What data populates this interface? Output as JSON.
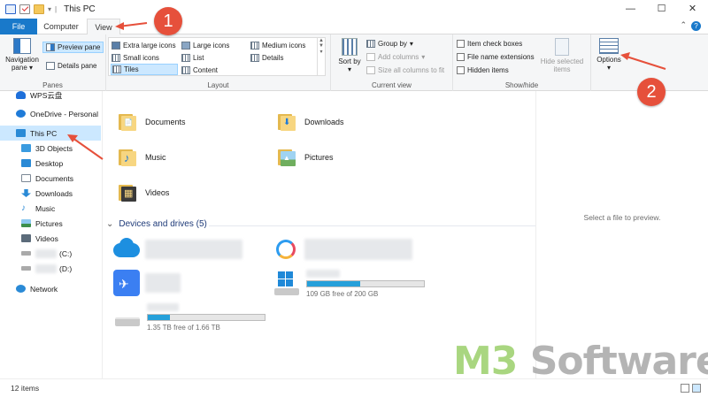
{
  "window": {
    "title": "This PC",
    "minimize": "—",
    "maximize": "☐",
    "close": "✕"
  },
  "tabs": {
    "file": "File",
    "computer": "Computer",
    "view": "View",
    "help": "?",
    "collapse": "⌃"
  },
  "ribbon": {
    "panes": {
      "label": "Panes",
      "navigation_pane": "Navigation pane",
      "preview_pane": "Preview pane",
      "details_pane": "Details pane"
    },
    "layout": {
      "label": "Layout",
      "options": [
        "Extra large icons",
        "Large icons",
        "Medium icons",
        "Small icons",
        "List",
        "Details",
        "Tiles",
        "Content"
      ],
      "selected": "Tiles"
    },
    "current_view": {
      "label": "Current view",
      "sort_by": "Sort by",
      "group_by": "Group by",
      "add_columns": "Add columns",
      "size_columns": "Size all columns to fit"
    },
    "show_hide": {
      "label": "Show/hide",
      "item_check_boxes": "Item check boxes",
      "file_name_extensions": "File name extensions",
      "hidden_items": "Hidden items",
      "hide_selected": "Hide selected items"
    },
    "options": {
      "label": "Options"
    }
  },
  "sidebar": {
    "items": [
      {
        "label": "WPS云盘",
        "icon": "cloud-icon",
        "color": "#1e6fd9"
      },
      {
        "label": "OneDrive - Personal",
        "icon": "onedrive-icon",
        "color": "#1f7bd8"
      },
      {
        "label": "This PC",
        "icon": "computer-icon",
        "color": "#2a8ad6",
        "selected": true
      },
      {
        "label": "3D Objects",
        "icon": "cube-icon",
        "color": "#3a9be0"
      },
      {
        "label": "Desktop",
        "icon": "desktop-icon",
        "color": "#2a8ad6"
      },
      {
        "label": "Documents",
        "icon": "document-icon",
        "color": "#7c8895"
      },
      {
        "label": "Downloads",
        "icon": "download-icon",
        "color": "#2a8ad6"
      },
      {
        "label": "Music",
        "icon": "music-icon",
        "color": "#2a8ad6"
      },
      {
        "label": "Pictures",
        "icon": "picture-icon",
        "color": "#4aa0d8"
      },
      {
        "label": "Videos",
        "icon": "video-icon",
        "color": "#5b6b7a"
      },
      {
        "label": "(C:)",
        "icon": "drive-icon",
        "color": "#8a8a8a"
      },
      {
        "label": "(D:)",
        "icon": "drive-icon",
        "color": "#8a8a8a"
      },
      {
        "label": "Network",
        "icon": "network-icon",
        "color": "#2a8ad6"
      }
    ]
  },
  "folders": [
    {
      "label": "Documents",
      "glyph": "📄"
    },
    {
      "label": "Downloads",
      "glyph": "⬇"
    },
    {
      "label": "Music",
      "glyph": "♪"
    },
    {
      "label": "Pictures",
      "glyph": "▲"
    },
    {
      "label": "Videos",
      "glyph": "▦"
    }
  ],
  "devices": {
    "header": "Devices and drives (5)",
    "drives": [
      {
        "free": "109 GB free of 200 GB",
        "used_fraction": 0.455
      },
      {
        "free": "1.35 TB free of 1.66 TB",
        "used_fraction": 0.19
      }
    ]
  },
  "preview": {
    "message": "Select a file to preview."
  },
  "status": {
    "items": "12 items"
  },
  "watermark": {
    "part1": "M3",
    "part2": " Software"
  },
  "annotations": {
    "step1": "1",
    "step2": "2"
  },
  "colors": {
    "accent": "#1979ca",
    "annotation": "#e6503b",
    "selection": "#cce8ff",
    "drive_fill": "#26a0da"
  }
}
